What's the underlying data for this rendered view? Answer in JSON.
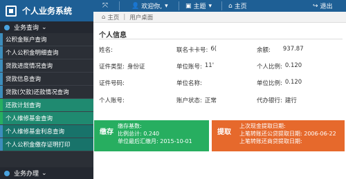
{
  "app": {
    "title": "个人业务系统"
  },
  "topbar": {
    "welcome_label": "欢迎你,",
    "theme_label": "主题",
    "home_label": "主页",
    "logout_label": "退出",
    "expand_icon": "expand-icon",
    "colors": {
      "bar": "#1e5f95"
    }
  },
  "breadcrumb": {
    "home_label": "主页",
    "current_label": "用户桌面"
  },
  "sidebar": {
    "group_label": "业务查询",
    "items": [
      {
        "label": "公积金账户查询"
      },
      {
        "label": "个人公积金明细查询"
      },
      {
        "label": "贷款进度情况查询"
      },
      {
        "label": "贷款信息查询"
      },
      {
        "label": "贷款(欠款)还款情况查询"
      },
      {
        "label": "还款计划查询"
      },
      {
        "label": "个人维修基金查询"
      },
      {
        "label": "个人维修基金利息查询"
      },
      {
        "label": "个人公积金缴存证明打印"
      }
    ],
    "bottom_group_label": "业务办理"
  },
  "main": {
    "section_title": "个人信息",
    "rows": [
      [
        {
          "label": "姓名:",
          "value": ""
        },
        {
          "label": "联名卡卡号:",
          "value": "6("
        },
        {
          "label": "余额:",
          "value": "937.87"
        }
      ],
      [
        {
          "label": "证件类型:",
          "value": "身份证"
        },
        {
          "label": "单位账号:",
          "value": "11' "
        },
        {
          "label": "个人比例:",
          "value": "0.120"
        }
      ],
      [
        {
          "label": "证件号码:",
          "value": ""
        },
        {
          "label": "单位名称:",
          "value": ""
        },
        {
          "label": "单位比例:",
          "value": "0.120"
        }
      ],
      [
        {
          "label": "个人账号:",
          "value": ""
        },
        {
          "label": "账户状态:",
          "value": "正常"
        },
        {
          "label": "代办银行:",
          "value": "建行"
        }
      ]
    ]
  },
  "cards": {
    "deposit": {
      "badge": "缴存",
      "lines": [
        "缴存基数:",
        "比例总计: 0.240",
        "单位最后汇缴月: 2015-10-01"
      ],
      "color": "#27ae60"
    },
    "withdraw": {
      "badge": "提取",
      "lines": [
        "上次现金提取日期:",
        "上笔转账还公贷提取日期: 2006-06-22",
        "上笔转账还商贷提取日期:"
      ],
      "color": "#e6692c"
    }
  }
}
